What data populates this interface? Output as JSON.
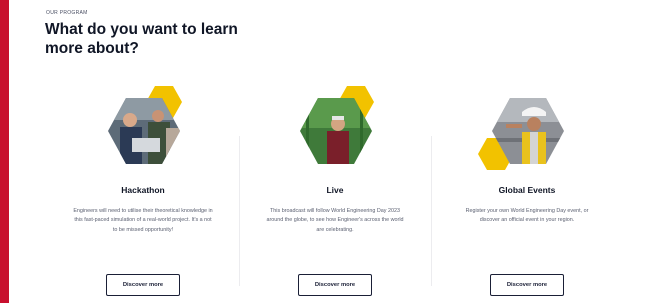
{
  "program": {
    "eyebrow": "OUR PROGRAM",
    "heading": "What do you want to learn more about?"
  },
  "colors": {
    "accent": "#c8102e",
    "hex_accent": "#f2c200",
    "text_dark": "#101626"
  },
  "cards": [
    {
      "title": "Hackathon",
      "description": "Engineers will need to utilise their theoretical knowledge in this fast-paced simulation of a real-world project. It's a not to be missed opportunity!",
      "button_label": "Discover more",
      "image": "hackathon-team-photo"
    },
    {
      "title": "Live",
      "description": "This broadcast will follow World Engineering Day 2023 around the globe, to see how Engineer's across the world are celebrating.",
      "button_label": "Discover more",
      "image": "live-broadcast-photo"
    },
    {
      "title": "Global Events",
      "description": "Register your own World Engineering Day event, or discover an official event in your region.",
      "button_label": "Discover more",
      "image": "global-events-engineer-photo"
    }
  ]
}
